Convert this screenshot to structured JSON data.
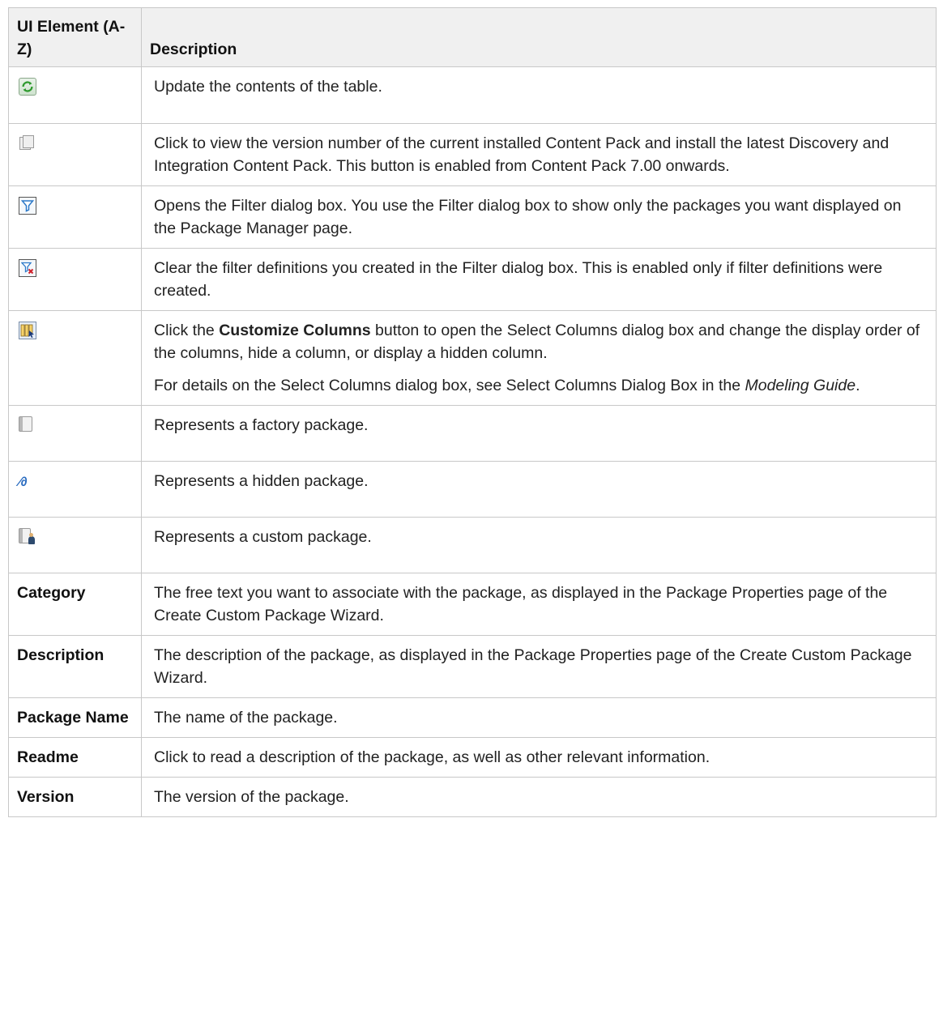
{
  "header": {
    "col1": "UI Element (A-Z)",
    "col2": "Description"
  },
  "rows": [
    {
      "icon": "refresh-icon",
      "desc": "Update the contents of the table."
    },
    {
      "icon": "content-pack-icon",
      "desc": "Click to view the version number of the current installed Content Pack and install the latest Discovery and Integration Content Pack. This button is enabled from Content Pack 7.00 onwards."
    },
    {
      "icon": "filter-icon",
      "desc": "Opens the Filter dialog box. You use the Filter dialog box to show only the packages you want displayed on the Package Manager page."
    },
    {
      "icon": "clear-filter-icon",
      "desc": "Clear the filter definitions you created in the Filter dialog box. This is enabled only if filter definitions were created."
    },
    {
      "icon": "customize-columns-icon",
      "desc_pre": "Click the ",
      "desc_bold": "Customize Columns",
      "desc_post": " button to open the Select Columns dialog box and change the display order of the columns, hide a column, or display a hidden column.",
      "desc2_pre": "For details on the Select Columns dialog box, see Select Columns Dialog Box in the ",
      "desc2_italic": "Modeling Guide",
      "desc2_post": "."
    },
    {
      "icon": "factory-package-icon",
      "desc": "Represents a factory package."
    },
    {
      "icon": "hidden-package-icon",
      "desc": "Represents a hidden package."
    },
    {
      "icon": "custom-package-icon",
      "desc": "Represents a custom package."
    },
    {
      "name": "Category",
      "desc": "The free text you want to associate with the package, as displayed in the Package Properties page of the Create Custom Package Wizard."
    },
    {
      "name": "Description",
      "desc": "The description of the package, as displayed in the Package Properties page of the Create Custom Package Wizard."
    },
    {
      "name": "Package Name",
      "desc": "The name of the package."
    },
    {
      "name": "Readme",
      "desc": "Click to read a description of the package, as well as other relevant information."
    },
    {
      "name": "Version",
      "desc": "The version of the package."
    }
  ],
  "colors": {
    "header_bg": "#f0f0f0",
    "border": "#c8c8c8",
    "refresh_green": "#2e9a2e",
    "filter_blue": "#2a78c8"
  }
}
